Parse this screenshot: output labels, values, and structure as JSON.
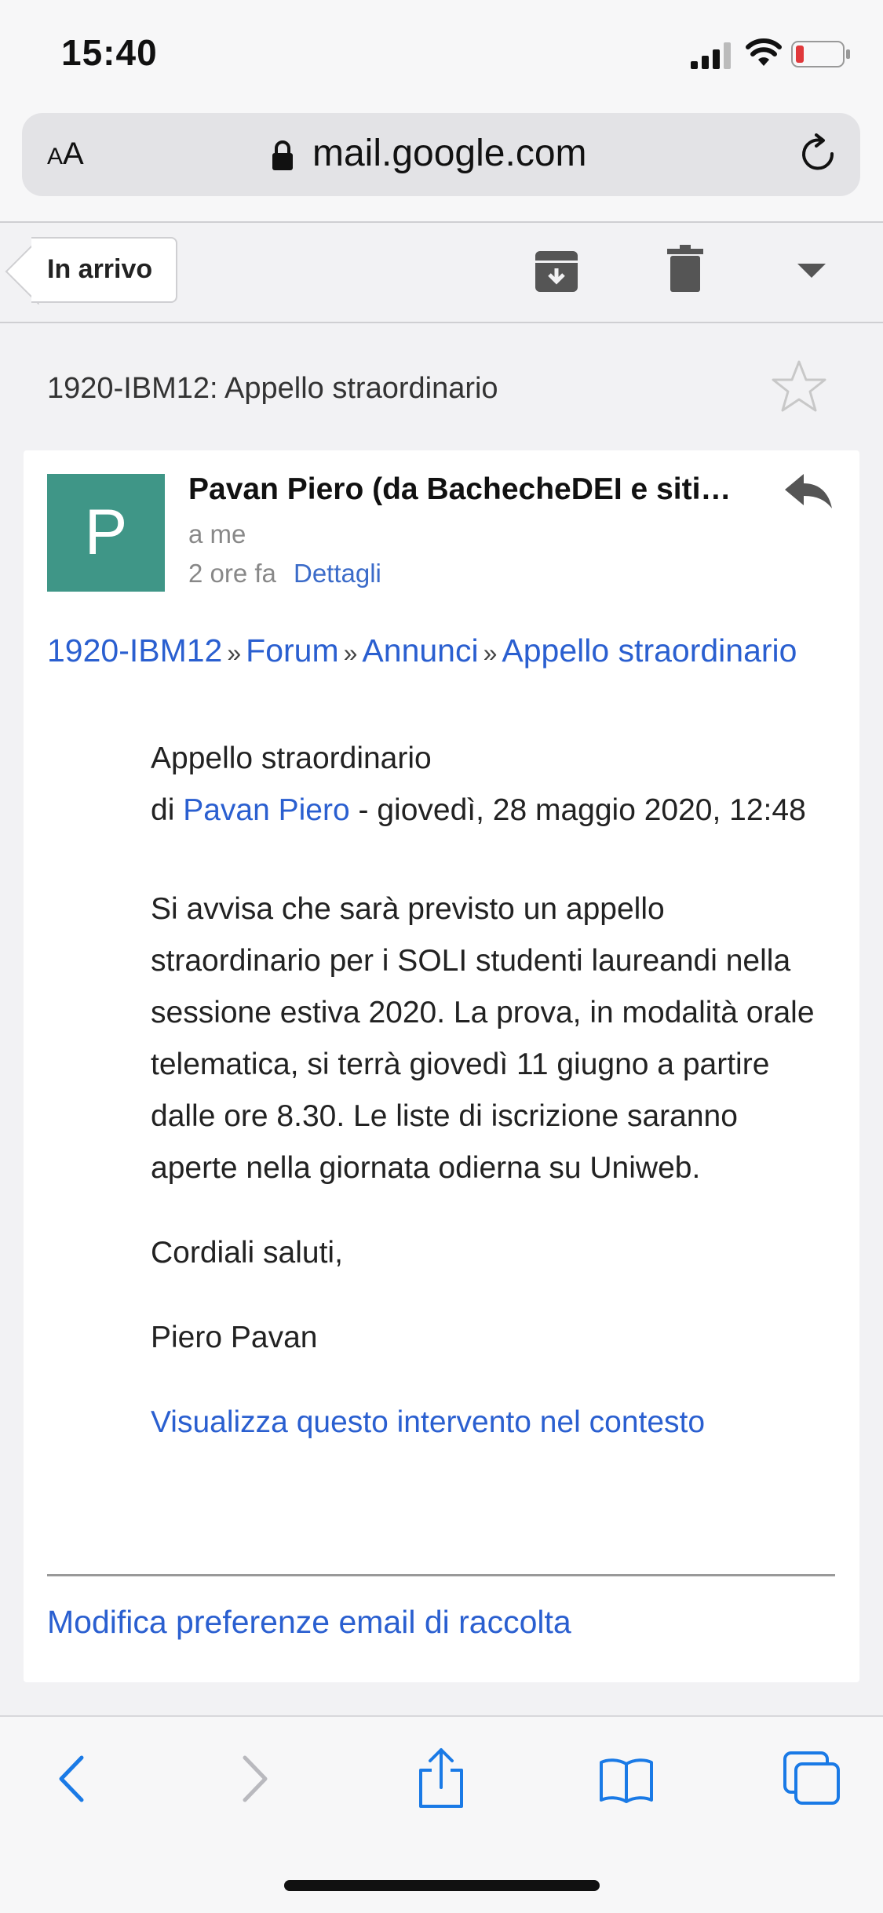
{
  "status_bar": {
    "time": "15:40"
  },
  "browser": {
    "text_size_label_small": "A",
    "text_size_label_large": "A",
    "url": "mail.google.com"
  },
  "toolbar": {
    "back_label": "In arrivo"
  },
  "email": {
    "subject": "1920-IBM12: Appello straordinario",
    "avatar_letter": "P",
    "avatar_color": "#3f9687",
    "sender": "Pavan Piero (da BachecheDEI e siti…",
    "to": "a me",
    "time": "2 ore fa",
    "details_label": "Dettagli",
    "breadcrumb": {
      "course": "1920-IBM12",
      "forum": "Forum",
      "announcements": "Annunci",
      "topic": "Appello straordinario",
      "separator": "»"
    },
    "post": {
      "title": "Appello straordinario",
      "by_prefix": "di",
      "author": "Pavan Piero",
      "date": "- giovedì, 28 maggio 2020, 12:48",
      "body": "Si avvisa che sarà previsto un appello straordinario per i SOLI studenti laureandi nella sessione estiva 2020. La prova, in modalità orale telematica, si terrà giovedì 11 giugno a partire dalle ore 8.30. Le liste di iscrizione saranno aperte nella giornata odierna su Uniweb.",
      "greeting": "Cordiali saluti,",
      "signature": "Piero Pavan",
      "context_link": "Visualizza questo intervento nel contesto"
    },
    "prefs_link": "Modifica preferenze email di raccolta"
  },
  "colors": {
    "link": "#2a5fd0",
    "accent": "#1a7ae6"
  },
  "bottom_nav": {
    "icons": [
      "back-arrow-icon",
      "forward-arrow-icon",
      "share-icon",
      "bookmarks-icon",
      "tabs-icon"
    ]
  }
}
